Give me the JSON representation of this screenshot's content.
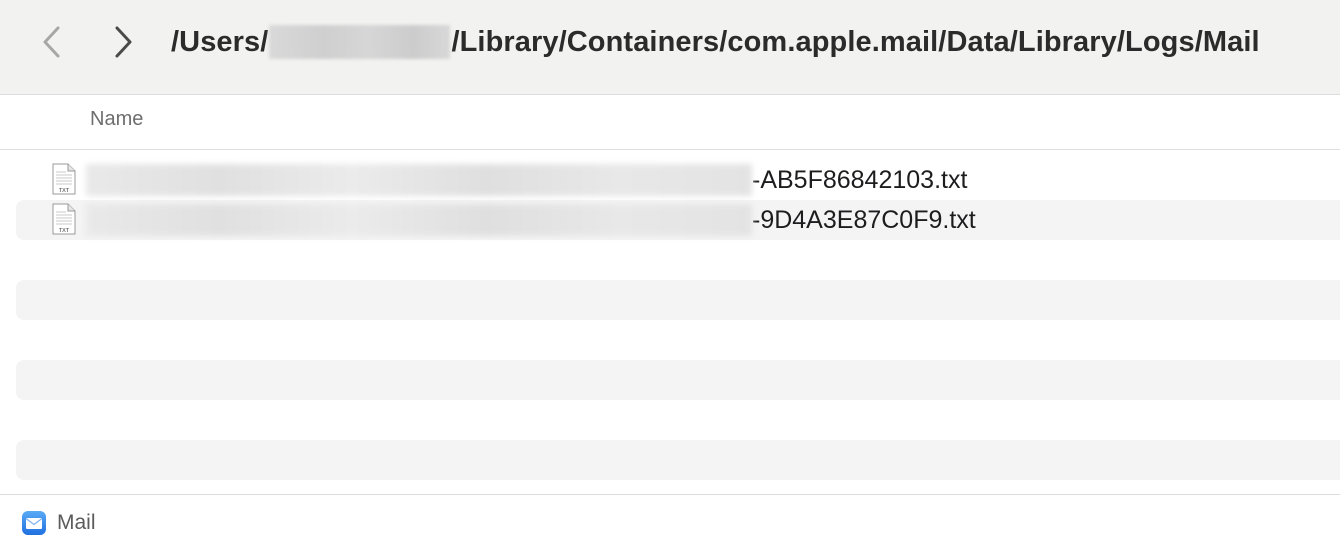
{
  "toolbar": {
    "back_icon": "chevron-left-icon",
    "forward_icon": "chevron-right-icon",
    "path_prefix": "/Users/",
    "path_suffix": "/Library/Containers/com.apple.mail/Data/Library/Logs/Mail"
  },
  "list": {
    "column_name": "Name",
    "files": [
      {
        "name_suffix": "-AB5F86842103.txt",
        "icon": "txt-file-icon",
        "icon_label": "TXT"
      },
      {
        "name_suffix": "-9D4A3E87C0F9.txt",
        "icon": "txt-file-icon",
        "icon_label": "TXT"
      }
    ]
  },
  "status_bar": {
    "icon": "mail-app-icon",
    "label": "Mail"
  },
  "colors": {
    "toolbar_bg": "#f2f2f0",
    "stripe_bg": "#f4f4f4",
    "mail_blue": "#3b8ef0"
  }
}
